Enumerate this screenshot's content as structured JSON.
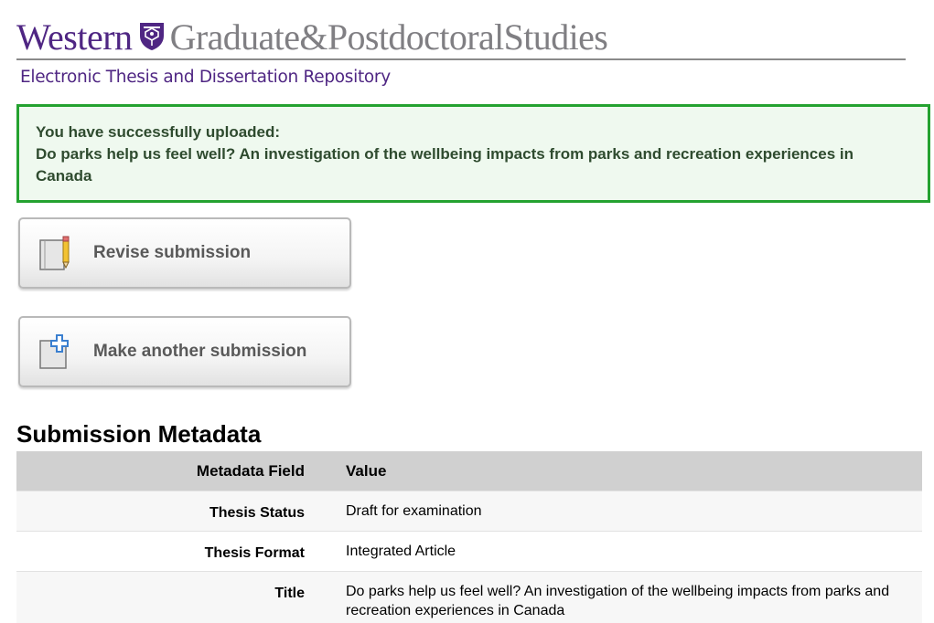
{
  "header": {
    "brand_name": "Western",
    "brand_subtitle": "Graduate&PostdoctoralStudies",
    "repository_title": "Electronic Thesis and Dissertation Repository",
    "brand_color": "#4f2683",
    "subtitle_color": "#807f83"
  },
  "success": {
    "line1": "You have successfully uploaded:",
    "line2": "Do parks help us feel well? An investigation of the wellbeing impacts from parks and recreation experiences in Canada",
    "border_color": "#24a230"
  },
  "actions": {
    "revise_label": "Revise submission",
    "revise_icon": "notebook-pencil-icon",
    "another_label": "Make another submission",
    "another_icon": "add-document-icon"
  },
  "metadata": {
    "heading": "Submission Metadata",
    "columns": [
      "Metadata Field",
      "Value"
    ],
    "rows": [
      {
        "field": "Thesis Status",
        "value": "Draft for examination"
      },
      {
        "field": "Thesis Format",
        "value": "Integrated Article"
      },
      {
        "field": "Title",
        "value": "Do parks help us feel well? An investigation of the wellbeing impacts from parks and recreation experiences in Canada"
      }
    ]
  }
}
